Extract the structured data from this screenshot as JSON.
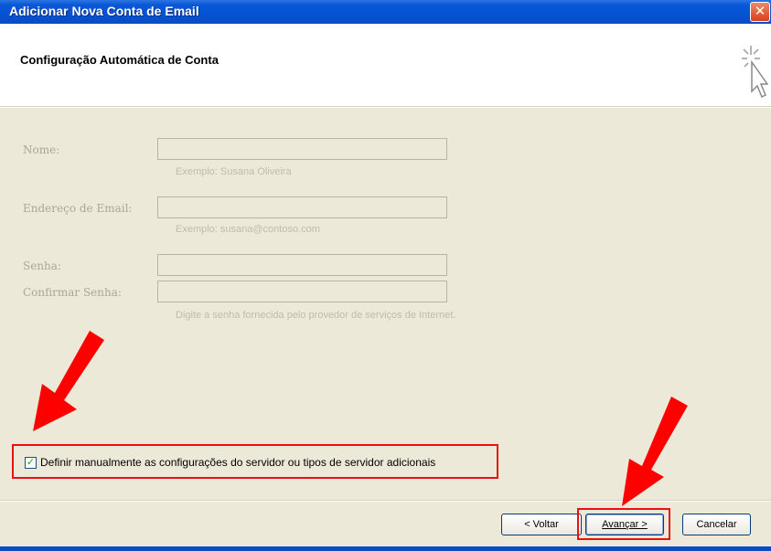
{
  "window": {
    "title": "Adicionar Nova Conta de Email",
    "close_glyph": "✕"
  },
  "header": {
    "title": "Configuração Automática de Conta",
    "icon": "wizard-cursor-sparkle-icon"
  },
  "form": {
    "name": {
      "label": "Nome:",
      "value": "",
      "hint": "Exemplo: Susana Oliveira"
    },
    "email": {
      "label": "Endereço de Email:",
      "value": "",
      "hint": "Exemplo: susana@contoso.com"
    },
    "password": {
      "label": "Senha:",
      "value": ""
    },
    "confirm_password": {
      "label": "Confirmar Senha:",
      "value": "",
      "hint": "Digite a senha fornecida pelo provedor de serviços de Internet."
    }
  },
  "manual_config": {
    "checked": true,
    "label": "Definir manualmente as configurações do servidor ou tipos de servidor adicionais"
  },
  "buttons": {
    "back": "< Voltar",
    "next": "Avançar >",
    "cancel": "Cancelar"
  },
  "annotations": {
    "highlight_color": "#e81010",
    "arrow_color": "#ff0000"
  }
}
